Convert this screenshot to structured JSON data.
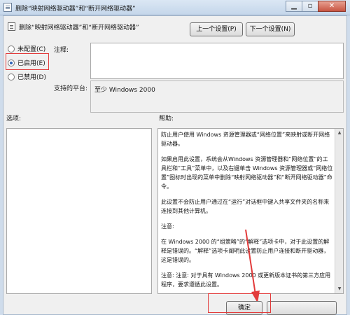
{
  "window": {
    "title": "删除“映射网络驱动器”和“断开网络驱动器”",
    "controls": {
      "minimize": "▁",
      "maximize": "▫",
      "close": "✕"
    }
  },
  "header": {
    "policy_name": "删除“映射网络驱动器”和“断开网络驱动器”",
    "prev_button": "上一个设置(P)",
    "next_button": "下一个设置(N)"
  },
  "state_options": [
    {
      "label": "未配置(C)",
      "selected": false
    },
    {
      "label": "已启用(E)",
      "selected": true
    },
    {
      "label": "已禁用(D)",
      "selected": false
    }
  ],
  "comment": {
    "label": "注释:",
    "value": ""
  },
  "platform": {
    "label": "支持的平台:",
    "value": "至少 Windows 2000"
  },
  "options": {
    "label": "选项:"
  },
  "help": {
    "label": "帮助:",
    "paragraphs": [
      "防止用户使用 Windows 资源管理器或“网络位置”来映射或断开网络驱动器。",
      "如果启用此设置，系统会从Windows 资源管理器和“网络位置”的工具栏和“工具”菜单中，以及右键单击 Windows 资源管理器或“网络位置”图标时出现的菜单中删除“映射网络驱动器”和“断开网络驱动器”命令。",
      "此设置不会防止用户通过在“运行”对话框中键入共享文件夹的名称来连接到其他计算机。",
      "注意:",
      "在 Windows 2000 的“组策略”的“解释”选项卡中，对于此设置的解释是错误的。“解释”选项卡阐明此设置防止用户连接和断开驱动器，这是错误的。",
      "注意: 注意: 对于具有 Windows 2000 或更新版本证书的第三方应用程序，要求遵循此设置。"
    ]
  },
  "footer": {
    "ok_button": "确定",
    "cancel_button": ""
  },
  "colors": {
    "highlight_red": "#e23b3b",
    "accent_blue": "#2a62b6"
  }
}
